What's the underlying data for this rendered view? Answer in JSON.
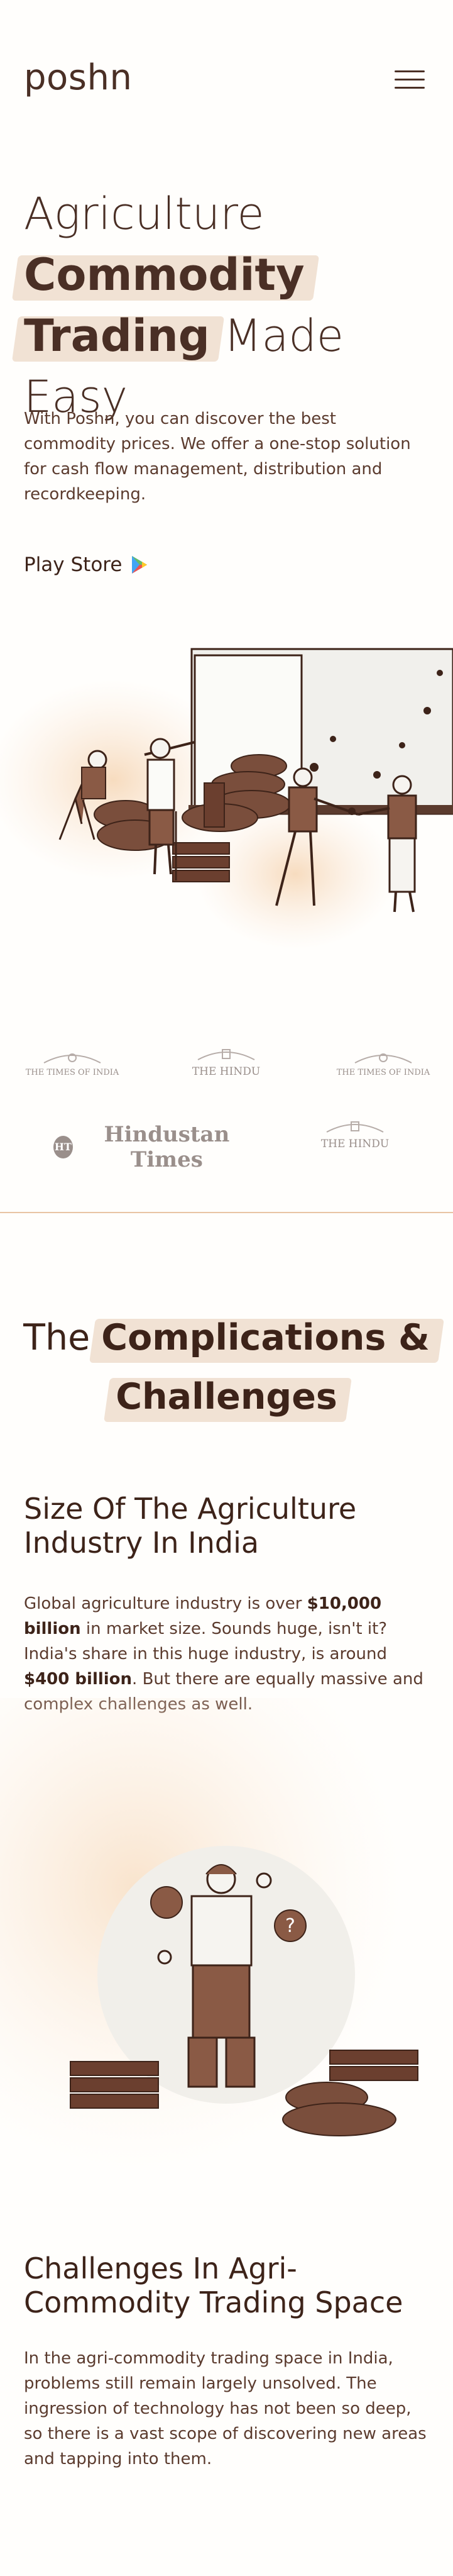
{
  "header": {
    "brand": "poshn",
    "menu_icon": "hamburger-menu-icon"
  },
  "hero": {
    "title_line1": "Agriculture",
    "title_highlight1": "Commodity",
    "title_highlight2": "Trading",
    "title_rest": " Made Easy",
    "description": "With Poshn, you can discover the best commodity prices. We offer a one-stop solution for cash flow management,  distribution and recordkeeping.",
    "play_store_label": "Play Store",
    "play_icon": "play-store-triangle-icon"
  },
  "press": {
    "logos": [
      "THE TIMES OF INDIA",
      "THE HINDU",
      "THE TIMES OF INDIA",
      "Hindustan Times",
      "THE HINDU"
    ]
  },
  "challenges": {
    "title_pre": "The ",
    "title_highlight1": "Complications &",
    "title_highlight2": "Challenges",
    "size_heading": "Size Of The Agriculture Industry In India",
    "size_p1_a": "Global agriculture industry is over ",
    "size_p1_b": "$10,000 billion",
    "size_p1_c": " in market size. Sounds huge, isn't it?",
    "size_p2_a": "India's share in this huge industry, is around ",
    "size_p2_b": "$400 billion",
    "size_p2_c": ". But there are equally massive and complex challenges as well.",
    "trading_heading": "Challenges In Agri-Commodity Trading Space",
    "trading_p": "In the agri-commodity trading space in India, problems still remain largely unsolved. The ingression of technology has not been so deep, so there is a vast scope of discovering new areas and tapping into them."
  },
  "colors": {
    "brand_brown": "#4a2f25",
    "accent_peach": "#f1e2d4",
    "divider": "#e8c4a4"
  }
}
